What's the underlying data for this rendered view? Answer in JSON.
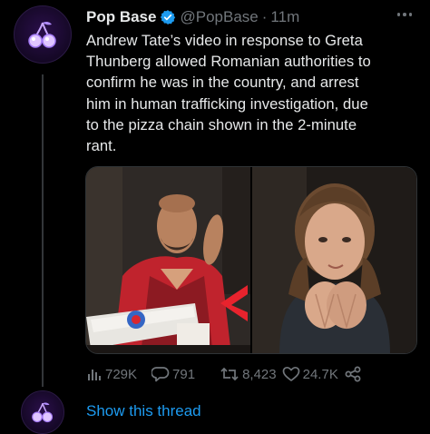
{
  "tweet": {
    "display_name": "Pop Base",
    "verified": true,
    "handle": "@PopBase",
    "separator": "·",
    "time": "11m",
    "text": "Andrew Tate’s video in response to Greta\nThunberg allowed Romanian authorities to\nconfirm he was in the country, and arrest\nhim in human trafficking investigation, due\nto the pizza chain shown in the 2-minute\nrant.",
    "media": [
      {
        "icon": "photo-andrew-tate"
      },
      {
        "icon": "photo-greta-thunberg"
      }
    ],
    "stats": {
      "views": "729K",
      "replies": "791",
      "retweets": "8,423",
      "likes": "24.7K"
    }
  },
  "thread": {
    "show_label": "Show this thread"
  },
  "colors": {
    "background": "#000000",
    "text": "#e7e9ea",
    "muted": "#71767b",
    "accent": "#1d9bf0",
    "verified": "#1d9bf0",
    "avatar_bg": "#150826"
  },
  "icons": {
    "avatar": "cherries-icon",
    "verified": "verified-badge-icon",
    "more": "more-icon",
    "views": "views-icon",
    "reply": "reply-icon",
    "retweet": "retweet-icon",
    "like": "heart-icon",
    "share": "share-icon"
  }
}
